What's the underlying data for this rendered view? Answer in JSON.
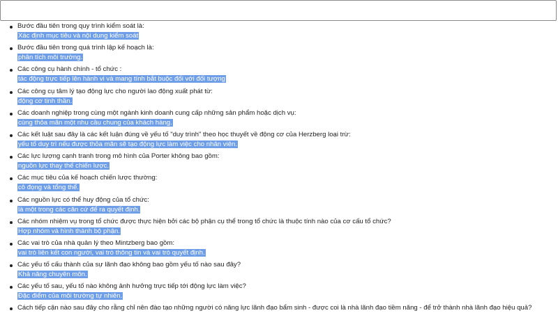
{
  "search": {
    "value": "",
    "placeholder": ""
  },
  "colors": {
    "highlight": "#6f9ee8",
    "text": "#222222",
    "border": "#8a8a8a"
  },
  "items": [
    {
      "question": "Bước đầu tiên trong quy trình kiểm soát là:",
      "answer": "Xác định mục tiêu và nội dung kiểm soát"
    },
    {
      "question": "Bước đầu tiên trong quá trình lập kế hoạch là:",
      "answer": "phân tích môi trường."
    },
    {
      "question": "Các công cụ hành chính - tổ chức :",
      "answer": "tác động trực tiếp lên hành vi và mang tính bắt buộc đối với đối tượng"
    },
    {
      "question": "Các công cụ tâm lý tạo động lực cho người lao động xuất phát từ:",
      "answer": "động cơ tinh thần."
    },
    {
      "question": "Các doanh nghiệp trong cùng một ngành kinh doanh cung cấp những sản phẩm hoặc dịch vụ:",
      "answer": "cùng thỏa mãn một nhu cầu chung của khách hàng."
    },
    {
      "question": "Các kết luật sau đây là các kết luận đúng về yếu tố \"duy trình\" theo học thuyết về động cơ của Herzberg loại trừ:",
      "answer": "yếu tố duy trì nếu được thỏa mãn sẽ tạo động lực làm việc cho nhân viên."
    },
    {
      "question": "Các lực lượng cạnh tranh trong mô hình của Porter không bao gồm:",
      "answer": "nguồn lực thay thế chiến lược."
    },
    {
      "question": "Các mục tiêu của kế hoạch chiến lược thường:",
      "answer": "cô đọng và tổng thể."
    },
    {
      "question": "Các nguồn lực có thể huy động của tổ chức:",
      "answer": "là một trong các căn cứ để ra quyết định."
    },
    {
      "question": "Các nhóm nhiệm vụ trong tổ chức được thực hiện bởi các bộ phận cụ thể trong tổ chức là thuộc tính nào của cơ cấu tổ chức?",
      "answer": "Hợp nhóm và hình thành bộ phận."
    },
    {
      "question": "Các vai trò của nhà quản lý theo Mintzberg bao gồm:",
      "answer": "vai trò liên kết con người, vai trò thông tin và vai trò quyết định."
    },
    {
      "question": "Các yếu tố cấu thành của sự lãnh đạo không bao gồm yếu tố nào sau đây?",
      "answer": "Khả năng chuyên môn."
    },
    {
      "question": "Các yếu tố sau, yếu tố nào không ảnh hưởng trực tiếp tới động lực làm việc?",
      "answer": "Đặc điểm của môi trường tự nhiên."
    },
    {
      "question": "Cách tiếp cận nào sau đây cho rằng chỉ nên đào tạo những người có năng lực lãnh đạo bẩm sinh - được coi là nhà lãnh đạo tiềm năng - để trở thành nhà lãnh đạo hiệu quả?",
      "answer": ""
    }
  ]
}
